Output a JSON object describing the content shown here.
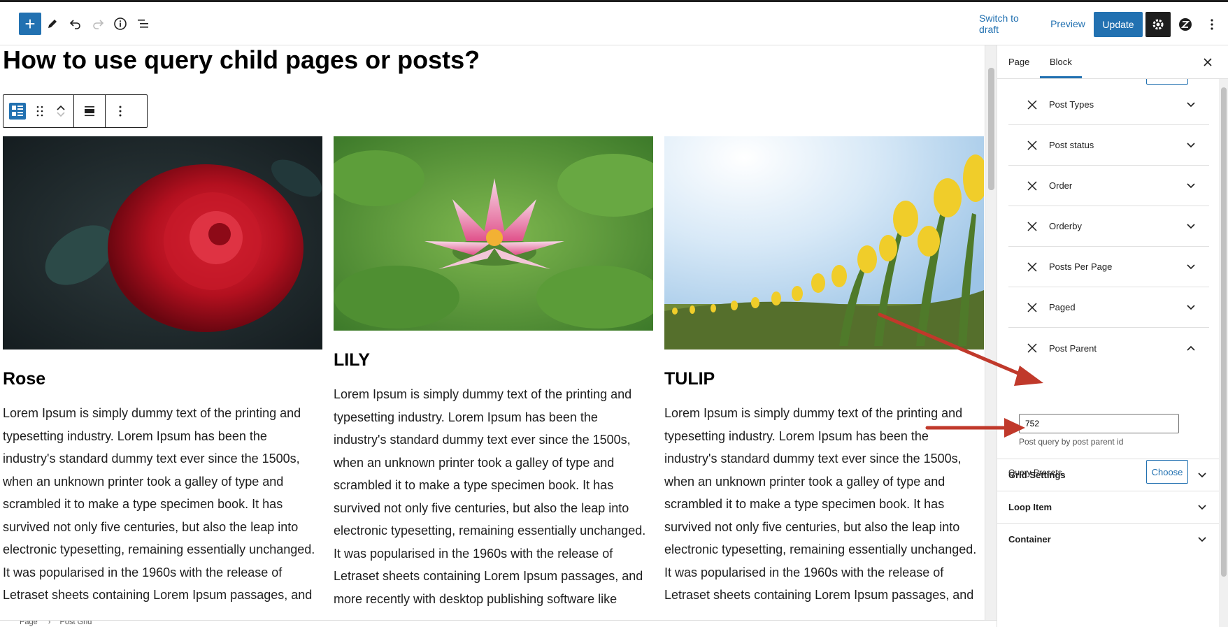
{
  "toolbar": {
    "add_block_label": "+",
    "switch_to_draft": "Switch to draft",
    "preview": "Preview",
    "update": "Update",
    "icons": [
      "plus-icon",
      "pencil-icon",
      "undo-icon",
      "redo-icon",
      "info-icon",
      "list-view-icon",
      "gear-icon",
      "z-logo-icon",
      "more-vertical-icon"
    ]
  },
  "page": {
    "title": "How to use query child pages or posts?"
  },
  "cards": [
    {
      "title": "Rose",
      "image": "red rose with water droplets",
      "text": "Lorem Ipsum is simply dummy text of the printing and typesetting industry. Lorem Ipsum has been the industry's standard dummy text ever since the 1500s, when an unknown printer took a galley of type and scrambled it to make a type specimen book. It has survived not only five centuries, but also the leap into electronic typesetting, remaining essentially unchanged. It was popularised in the 1960s with the release of Letraset sheets containing Lorem Ipsum passages, and"
    },
    {
      "title": "LILY",
      "image": "pink water lily on green pads",
      "text": "Lorem Ipsum is simply dummy text of the printing and typesetting industry. Lorem Ipsum has been the industry's standard dummy text ever since the 1500s, when an unknown printer took a galley of type and scrambled it to make a type specimen book. It has survived not only five centuries, but also the leap into electronic typesetting, remaining essentially unchanged. It was popularised in the 1960s with the release of Letraset sheets containing Lorem Ipsum passages, and more recently with desktop publishing software like"
    },
    {
      "title": "TULIP",
      "image": "yellow tulips under bright sky",
      "text": "Lorem Ipsum is simply dummy text of the printing and typesetting industry. Lorem Ipsum has been the industry's standard dummy text ever since the 1500s, when an unknown printer took a galley of type and scrambled it to make a type specimen book. It has survived not only five centuries, but also the leap into electronic typesetting, remaining essentially unchanged. It was popularised in the 1960s with the release of Letraset sheets containing Lorem Ipsum passages, and"
    }
  ],
  "breadcrumb": {
    "items": [
      "Page",
      "Post Grid"
    ],
    "separator": "›"
  },
  "sidebar": {
    "tabs": [
      "Page",
      "Block"
    ],
    "active_tab": "Block",
    "query_items": [
      {
        "label": "Post Types",
        "expanded": false
      },
      {
        "label": "Post status",
        "expanded": false
      },
      {
        "label": "Order",
        "expanded": false
      },
      {
        "label": "Orderby",
        "expanded": false
      },
      {
        "label": "Posts Per Page",
        "expanded": false
      },
      {
        "label": "Paged",
        "expanded": false
      },
      {
        "label": "Post Parent",
        "expanded": true
      }
    ],
    "post_parent": {
      "value": "752",
      "help": "Post query by post parent id"
    },
    "query_presets": {
      "label": "Query Presets",
      "button": "Choose"
    },
    "panels": [
      "Grid Settings",
      "Loop Item",
      "Container"
    ]
  },
  "colors": {
    "accent": "#2271b1",
    "dark": "#1e1e1e",
    "annotation_arrow": "#c0392b"
  }
}
